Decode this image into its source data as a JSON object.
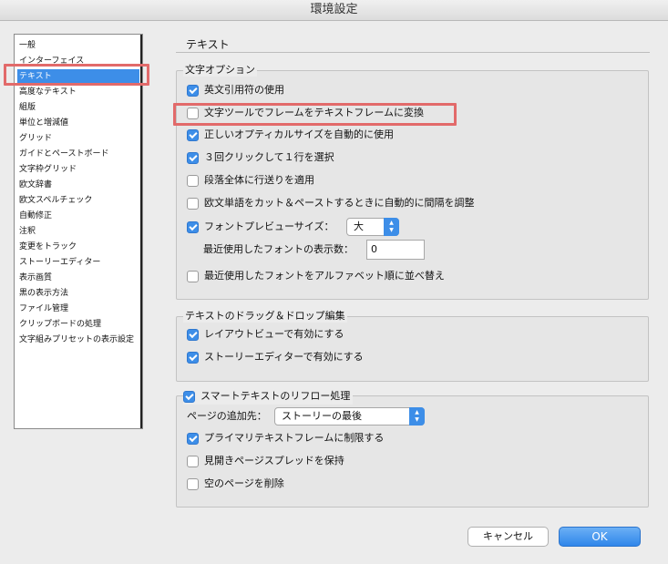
{
  "window": {
    "title": "環境設定"
  },
  "sidebar": {
    "items": [
      {
        "label": "一般",
        "selected": false
      },
      {
        "label": "インターフェイス",
        "selected": false
      },
      {
        "label": "テキスト",
        "selected": true
      },
      {
        "label": "高度なテキスト",
        "selected": false
      },
      {
        "label": "組版",
        "selected": false
      },
      {
        "label": "単位と増減値",
        "selected": false
      },
      {
        "label": "グリッド",
        "selected": false
      },
      {
        "label": "ガイドとペーストボード",
        "selected": false
      },
      {
        "label": "文字枠グリッド",
        "selected": false
      },
      {
        "label": "欧文辞書",
        "selected": false
      },
      {
        "label": "欧文スペルチェック",
        "selected": false
      },
      {
        "label": "自動修正",
        "selected": false
      },
      {
        "label": "注釈",
        "selected": false
      },
      {
        "label": "変更をトラック",
        "selected": false
      },
      {
        "label": "ストーリーエディター",
        "selected": false
      },
      {
        "label": "表示画質",
        "selected": false
      },
      {
        "label": "黒の表示方法",
        "selected": false
      },
      {
        "label": "ファイル管理",
        "selected": false
      },
      {
        "label": "クリップボードの処理",
        "selected": false
      },
      {
        "label": "文字組みプリセットの表示設定",
        "selected": false
      }
    ]
  },
  "panel": {
    "title": "テキスト",
    "char_options": {
      "legend": "文字オプション",
      "typographers_quotes": {
        "label": "英文引用符の使用",
        "checked": true
      },
      "type_tool_converts": {
        "label": "文字ツールでフレームをテキストフレームに変換",
        "checked": false
      },
      "optical_size": {
        "label": "正しいオプティカルサイズを自動的に使用",
        "checked": true
      },
      "triple_click": {
        "label": "３回クリックして１行を選択",
        "checked": true
      },
      "apply_leading": {
        "label": "段落全体に行送りを適用",
        "checked": false
      },
      "adjust_spacing": {
        "label": "欧文単語をカット＆ペーストするときに自動的に間隔を調整",
        "checked": false
      },
      "font_preview": {
        "label": "フォントプレビューサイズ：",
        "checked": true,
        "value": "大"
      },
      "recent_fonts": {
        "label": "最近使用したフォントの表示数：",
        "value": "0"
      },
      "sort_recent": {
        "label": "最近使用したフォントをアルファベット順に並べ替え",
        "checked": false
      }
    },
    "drag_drop": {
      "legend": "テキストのドラッグ＆ドロップ編集",
      "layout_view": {
        "label": "レイアウトビューで有効にする",
        "checked": true
      },
      "story_editor": {
        "label": "ストーリーエディターで有効にする",
        "checked": true
      }
    },
    "smart_reflow": {
      "legend": "スマートテキストのリフロー処理",
      "checked": true,
      "add_pages": {
        "label": "ページの追加先：",
        "value": "ストーリーの最後"
      },
      "limit_primary": {
        "label": "プライマリテキストフレームに制限する",
        "checked": true
      },
      "preserve_spreads": {
        "label": "見開きページスプレッドを保持",
        "checked": false
      },
      "delete_empty": {
        "label": "空のページを削除",
        "checked": false
      }
    }
  },
  "buttons": {
    "cancel": "キャンセル",
    "ok": "OK"
  },
  "colors": {
    "accent": "#3d8ee8",
    "highlight": "#e26a6a"
  }
}
